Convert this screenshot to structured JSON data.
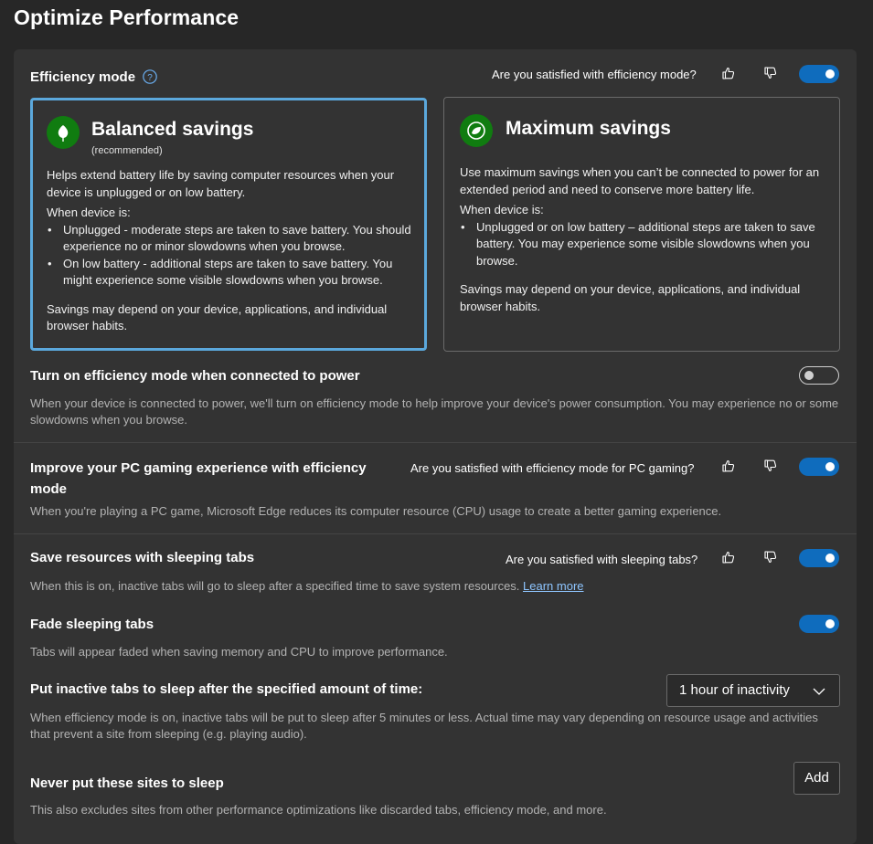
{
  "page": {
    "title": "Optimize Performance"
  },
  "efficiency": {
    "title": "Efficiency mode",
    "help_icon": "question-circle-icon",
    "question": "Are you satisfied with efficiency mode?",
    "enabled": true,
    "cards": [
      {
        "title": "Balanced savings",
        "subtitle": "(recommended)",
        "selected": true,
        "intro": "Helps extend battery life by saving computer resources when your device is unplugged or on low battery.",
        "when": "When device is:",
        "bullets": [
          "Unplugged - moderate steps are taken to save battery. You should experience no or minor slowdowns when you browse.",
          "On low battery - additional steps are taken to save battery. You might experience some visible slowdowns when you browse."
        ],
        "footer": "Savings may depend on your device, applications, and individual browser habits."
      },
      {
        "title": "Maximum savings",
        "subtitle": "",
        "selected": false,
        "intro": "Use maximum savings when you can’t be connected to power for an extended period and need to conserve more battery life.",
        "when": "When device is:",
        "bullets": [
          "Unplugged or on low battery – additional steps are taken to save battery. You may experience some visible slowdowns when you browse."
        ],
        "footer": "Savings may depend on your device, applications, and individual browser habits."
      }
    ]
  },
  "power": {
    "title": "Turn on efficiency mode when connected to power",
    "description": "When your device is connected to power, we'll turn on efficiency mode to help improve your device's power consumption. You may experience no or some slowdowns when you browse.",
    "enabled": false
  },
  "gaming": {
    "title": "Improve your PC gaming experience with efficiency mode",
    "question": "Are you satisfied with efficiency mode for PC gaming?",
    "description": "When you're playing a PC game, Microsoft Edge reduces its computer resource (CPU) usage to create a better gaming experience.",
    "enabled": true
  },
  "sleeping": {
    "title": "Save resources with sleeping tabs",
    "question": "Are you satisfied with sleeping tabs?",
    "description": "When this is on, inactive tabs will go to sleep after a specified time to save system resources.",
    "learn_more": "Learn more",
    "enabled": true
  },
  "fade": {
    "title": "Fade sleeping tabs",
    "description": "Tabs will appear faded when saving memory and CPU to improve performance.",
    "enabled": true
  },
  "inactive": {
    "title": "Put inactive tabs to sleep after the specified amount of time:",
    "description": "When efficiency mode is on, inactive tabs will be put to sleep after 5 minutes or less. Actual time may vary depending on resource usage and activities that prevent a site from sleeping (e.g. playing audio).",
    "selected": "1 hour of inactivity"
  },
  "never": {
    "title": "Never put these sites to sleep",
    "description": "This also excludes sites from other performance optimizations like discarded tabs, efficiency mode, and more.",
    "add_label": "Add"
  },
  "colors": {
    "accent": "#0f6cbd",
    "selected_border": "#5ba8dc",
    "leaf_green": "#107c10"
  }
}
